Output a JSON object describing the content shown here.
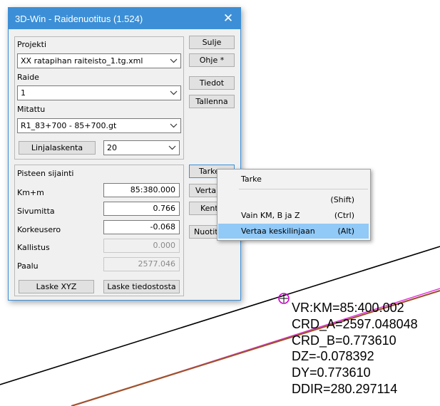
{
  "dialog": {
    "title": "3D-Win - Raidenuotitus  (1.524)",
    "close_glyph": "✕",
    "projekti_label": "Projekti",
    "projekti_value": "XX ratapihan raiteisto_1.tg.xml",
    "raide_label": "Raide",
    "raide_value": "1",
    "mitattu_label": "Mitattu",
    "mitattu_value": "R1_83+700 - 85+700.gt",
    "linjalaskenta_button": "Linjalaskenta",
    "linjalaskenta_value": "20",
    "buttons": {
      "sulje": "Sulje",
      "ohje": "Ohje *",
      "tiedot": "Tiedot",
      "tallenna": "Tallenna",
      "tarke": "Tarke",
      "vertaa": "Vertai",
      "kent": "Kent",
      "nuotitus": "Nuotitu"
    },
    "pisteen": {
      "heading": "Pisteen sijainti",
      "km_label": "Km+m",
      "km_value": "85:380.000",
      "sivumitta_label": "Sivumitta",
      "sivumitta_value": "0.766",
      "korkeusero_label": "Korkeusero",
      "korkeusero_value": "-0.068",
      "kallistus_label": "Kallistus",
      "kallistus_value": "0.000",
      "paalu_label": "Paalu",
      "paalu_value": "2577.046",
      "laske_xyz": "Laske XYZ",
      "laske_tiedostosta": "Laske tiedostosta"
    }
  },
  "context_menu": {
    "items": [
      {
        "label": "Tarke",
        "shortcut": ""
      },
      {
        "label": "",
        "shortcut": "(Shift)"
      },
      {
        "label": "Vain KM, B ja Z",
        "shortcut": "(Ctrl)"
      },
      {
        "label": "Vertaa keskilinjaan",
        "shortcut": "(Alt)"
      }
    ]
  },
  "readout": {
    "lines": [
      "VR:KM=85:400.002",
      "CRD_A=2597.048048",
      "CRD_B=0.773610",
      "DZ=-0.078392",
      "DY=0.773610",
      "DDIR=280.297114"
    ]
  },
  "colors": {
    "title_bar": "#3c8fd6",
    "menu_highlight": "#91c9f7",
    "track_brown": "#a0522d",
    "track_magenta": "#e030e0",
    "marker": "#cc00cc"
  }
}
